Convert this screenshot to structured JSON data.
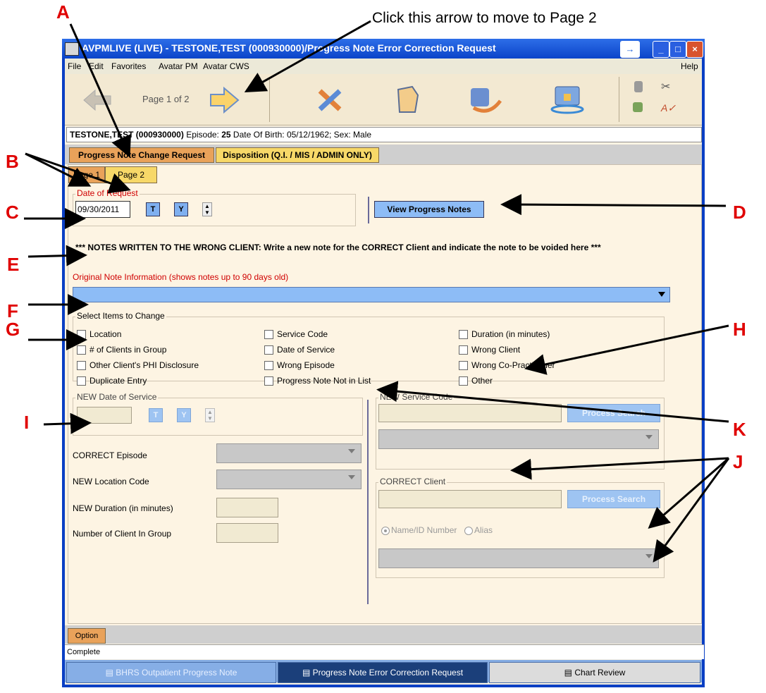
{
  "annotations": {
    "callout": "Click this arrow to move to Page 2",
    "A": "A",
    "B": "B",
    "C": "C",
    "D": "D",
    "E": "E",
    "F": "F",
    "G": "G",
    "H": "H",
    "I": "I",
    "J": "J",
    "K": "K"
  },
  "window": {
    "title": "AVPMLIVE (LIVE) - TESTONE,TEST (000930000)/Progress Note Error Correction Request",
    "menu": [
      "File",
      "Edit",
      "Favorites",
      "Avatar PM",
      "Avatar CWS"
    ],
    "help": "Help"
  },
  "toolbar": {
    "page_indicator": "Page 1 of 2"
  },
  "client_info": {
    "name": "TESTONE,TEST (000930000)",
    "episode_label": " Episode: ",
    "episode": "25",
    "rest": " Date Of Birth: 05/12/1962; Sex: Male"
  },
  "tabs": {
    "request": "Progress Note Change Request",
    "disposition": "Disposition (Q.I. / MIS / ADMIN ONLY)"
  },
  "subtabs": {
    "page1": "Page 1",
    "page2": "Page 2"
  },
  "date_request": {
    "legend": "Date of Request",
    "value": "09/30/2011",
    "t": "T",
    "y": "Y"
  },
  "view_notes_button": "View Progress Notes",
  "notice": "*** NOTES WRITTEN TO THE WRONG CLIENT: Write a new note for the CORRECT Client and indicate the note to be voided here ***",
  "original_note_label": "Original Note Information (shows notes up to 90 days old)",
  "select_items": {
    "legend": "Select Items to Change",
    "col1": [
      "Location",
      "# of Clients in Group",
      "Other Client's PHI Disclosure",
      "Duplicate Entry"
    ],
    "col2": [
      "Service Code",
      "Date of Service",
      "Wrong Episode",
      "Progress Note Not in List"
    ],
    "col3": [
      "Duration (in minutes)",
      "Wrong Client",
      "Wrong Co-Practitioner",
      "Other"
    ]
  },
  "new_date": {
    "legend": "NEW Date of Service",
    "t": "T",
    "y": "Y"
  },
  "left_fields": {
    "episode": "CORRECT Episode",
    "location": "NEW Location Code",
    "duration": "NEW Duration (in minutes)",
    "clients": "Number of Client In Group"
  },
  "new_service": {
    "legend": "NEW Service Code",
    "search": "Process Search"
  },
  "correct_client": {
    "legend": "CORRECT Client",
    "search": "Process Search",
    "radio1": "Name/ID Number",
    "radio2": "Alias"
  },
  "option_tab": "Option",
  "status": "Complete",
  "taskbar": [
    "BHRS Outpatient Progress Note",
    "Progress Note Error Correction Request",
    "Chart Review"
  ],
  "colors": {
    "accent_tab": "#e9a25a",
    "yellow_tab": "#f7d868",
    "field_blue": "#8dbcf6",
    "annotation_red": "#e00000"
  }
}
